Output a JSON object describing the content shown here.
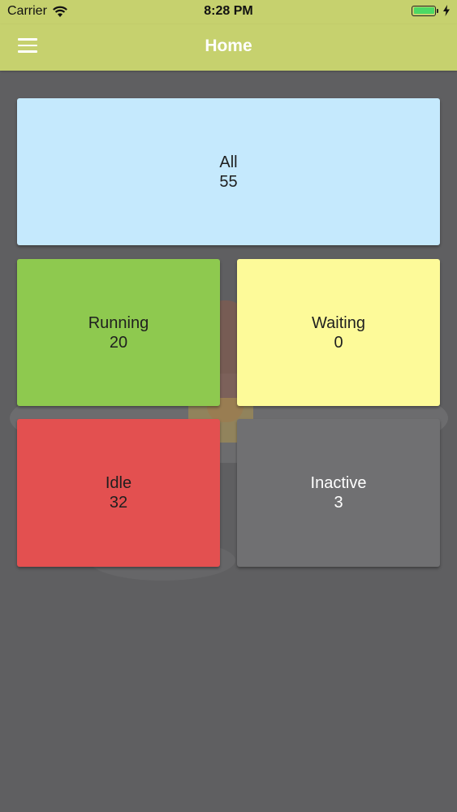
{
  "status_bar": {
    "carrier": "Carrier",
    "time": "8:28 PM"
  },
  "nav": {
    "title": "Home"
  },
  "tiles": [
    {
      "label": "All",
      "count": "55",
      "color": "#c5e9fd",
      "text_color": "#1f1f1f"
    },
    {
      "label": "Running",
      "count": "20",
      "color": "#8ec94f",
      "text_color": "#1f1f1f"
    },
    {
      "label": "Waiting",
      "count": "0",
      "color": "#fdfa99",
      "text_color": "#1f1f1f"
    },
    {
      "label": "Idle",
      "count": "32",
      "color": "#e35050",
      "text_color": "#1f1f1f"
    },
    {
      "label": "Inactive",
      "count": "3",
      "color": "#707072",
      "text_color": "#ffffff"
    }
  ],
  "colors": {
    "header": "#c6d16e",
    "background": "#5f5f61",
    "battery": "#4cd964"
  },
  "icons": {
    "menu": "hamburger-menu-icon",
    "wifi": "wifi-icon",
    "battery": "battery-icon",
    "charging": "charging-bolt-icon"
  }
}
